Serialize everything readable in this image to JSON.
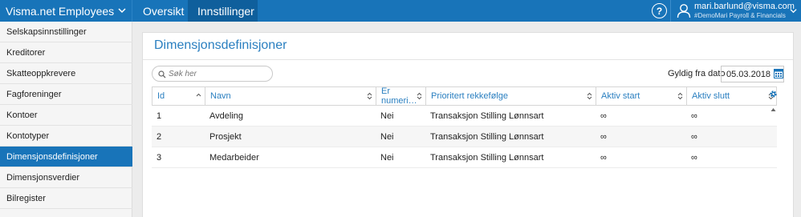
{
  "topbar": {
    "brand": "Visma.net Employees",
    "tabs": [
      {
        "label": "Oversikt",
        "active": false
      },
      {
        "label": "Innstillinger",
        "active": true
      }
    ],
    "help": "?",
    "user": {
      "email": "mari.barlund@visma.com",
      "company": "#DemoMari Payroll & Financials"
    }
  },
  "sidebar": {
    "items": [
      {
        "label": "Selskapsinnstillinger",
        "active": false
      },
      {
        "label": "Kreditorer",
        "active": false
      },
      {
        "label": "Skatteoppkrevere",
        "active": false
      },
      {
        "label": "Fagforeninger",
        "active": false
      },
      {
        "label": "Kontoer",
        "active": false
      },
      {
        "label": "Kontotyper",
        "active": false
      },
      {
        "label": "Dimensjonsdefinisjoner",
        "active": true
      },
      {
        "label": "Dimensjonsverdier",
        "active": false
      },
      {
        "label": "Bilregister",
        "active": false
      }
    ]
  },
  "main": {
    "title": "Dimensjonsdefinisjoner",
    "search_placeholder": "Søk her",
    "valid_from_label": "Gyldig fra dato",
    "valid_from_value": "05.03.2018",
    "table": {
      "columns": [
        "Id",
        "Navn",
        "Er numeri…",
        "Prioritert rekkefølge",
        "Aktiv start",
        "Aktiv slutt"
      ],
      "rows": [
        [
          "1",
          "Avdeling",
          "Nei",
          "Transaksjon Stilling Lønnsart",
          "∞",
          "∞"
        ],
        [
          "2",
          "Prosjekt",
          "Nei",
          "Transaksjon Stilling Lønnsart",
          "∞",
          "∞"
        ],
        [
          "3",
          "Medarbeider",
          "Nei",
          "Transaksjon Stilling Lønnsart",
          "∞",
          "∞"
        ]
      ]
    }
  },
  "colors": {
    "brand_blue": "#1874b9",
    "active_tab": "#0f5f9c",
    "heading_blue": "#2a7fc0"
  }
}
